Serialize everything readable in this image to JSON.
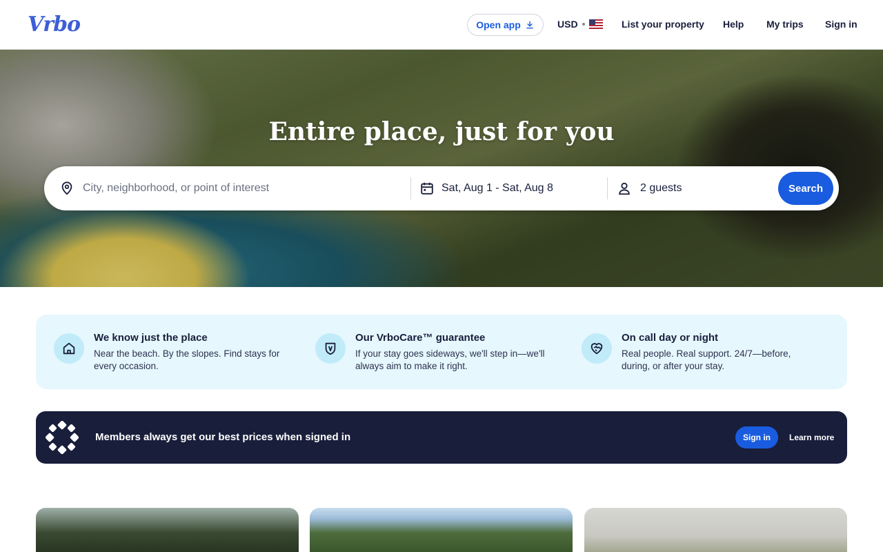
{
  "header": {
    "logo": "Vrbo",
    "open_app_label": "Open app",
    "currency": "USD",
    "nav": [
      "List your property",
      "Help",
      "My trips",
      "Sign in"
    ]
  },
  "hero": {
    "title": "Entire place, just for you",
    "search": {
      "destination_placeholder": "City, neighborhood, or point of interest",
      "dates_value": "Sat, Aug 1 - Sat, Aug 8",
      "guests_value": "2 guests",
      "button_label": "Search"
    }
  },
  "value_props": [
    {
      "title": "We know just the place",
      "text": "Near the beach. By the slopes. Find stays for every occasion.",
      "icon": "house-icon"
    },
    {
      "title": "Our VrboCare™ guarantee",
      "text": "If your stay goes sideways, we'll step in—we'll always aim to make it right.",
      "icon": "shield-icon"
    },
    {
      "title": "On call day or night",
      "text": "Real people. Real support. 24/7—before, during, or after your stay.",
      "icon": "heart-handshake-icon"
    }
  ],
  "members_banner": {
    "text": "Members always get our best prices when signed in",
    "signin_label": "Sign in",
    "learn_more_label": "Learn more"
  },
  "colors": {
    "brand_blue": "#1a5ce0",
    "navy": "#191e3b",
    "props_bg": "#e6f7fd"
  }
}
